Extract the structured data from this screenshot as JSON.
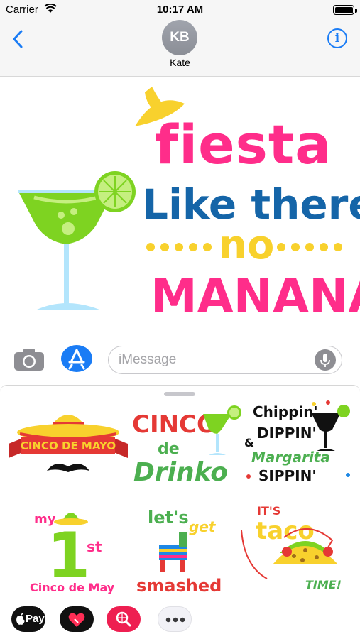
{
  "status_bar": {
    "carrier": "Carrier",
    "time": "10:17 AM"
  },
  "nav": {
    "contact_initials": "KB",
    "contact_name": "Kate"
  },
  "message_sticker": {
    "line1": "fiesta",
    "line2": "Like there's",
    "line3": "no",
    "line4": "MANANA"
  },
  "compose": {
    "placeholder": "iMessage"
  },
  "stickers": [
    {
      "text": "CINCO DE MAYO"
    },
    {
      "line1": "CINCO",
      "line2": "de",
      "line3": "Drinko"
    },
    {
      "line1": "Chippin'",
      "line2": "DIPPIN'",
      "line3": "&",
      "line4": "Margarita",
      "line5": "SIPPIN'"
    },
    {
      "line1": "my",
      "line2": "1",
      "line3": "st",
      "line4": "Cinco de Mayo"
    },
    {
      "line1": "let's",
      "line2": "get",
      "line3": "smashed"
    },
    {
      "line1": "IT'S",
      "line2": "taco",
      "line3": "TIME!"
    }
  ],
  "dock": {
    "applepay_label": "Pay"
  }
}
